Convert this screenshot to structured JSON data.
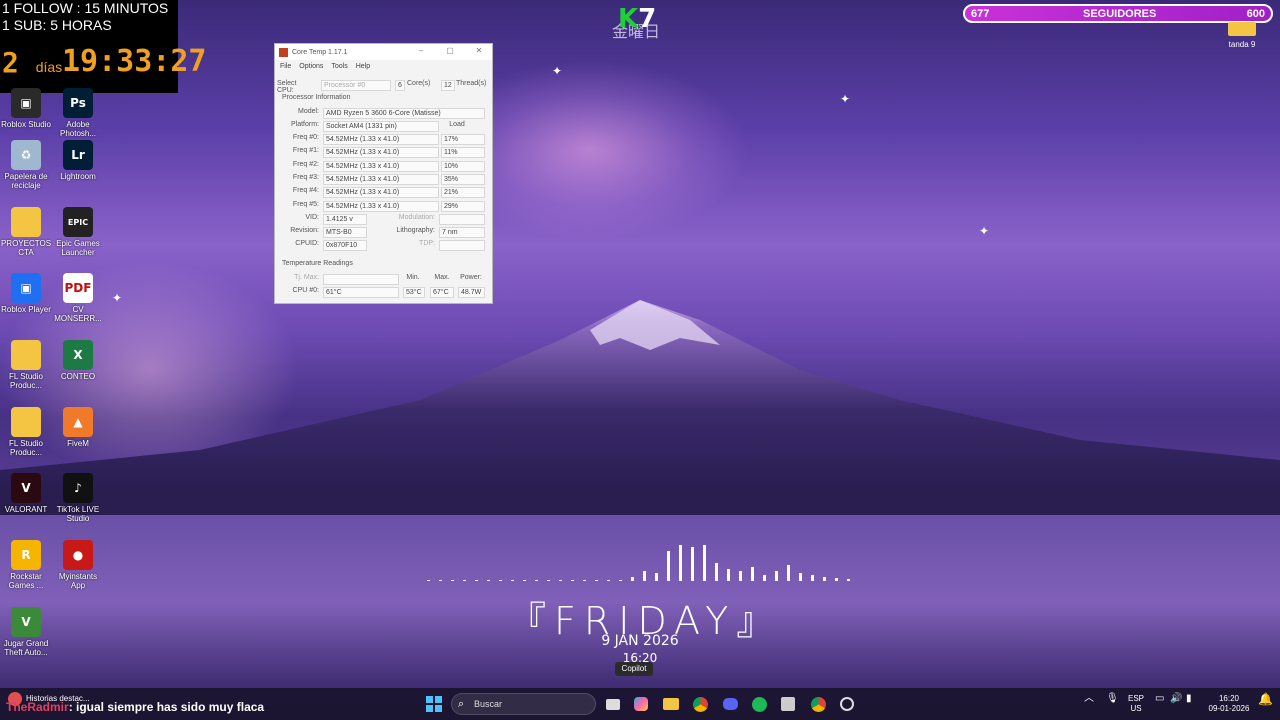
{
  "overlay": {
    "follow_goal": "1 FOLLOW : 15 MINUTOS",
    "sub_goal": "1 SUB: 5 HORAS",
    "timer_days": "2",
    "timer_days_unit": "días",
    "timer_clock": "19:33:27"
  },
  "logo": {
    "k": "K",
    "seven": "7",
    "kanji": "金曜日"
  },
  "followers_bar": {
    "current": "677",
    "label": "SEGUIDORES",
    "goal": "600",
    "fill_fraction": 1.0
  },
  "top_right_folder": {
    "label": "tanda 9"
  },
  "desktop_icons": [
    {
      "label": "Roblox Studio",
      "icon": "roblox-studio-icon"
    },
    {
      "label": "Adobe Photosh...",
      "icon": "photoshop-icon"
    },
    {
      "label": "Papelera de reciclaje",
      "icon": "recycle-bin-icon"
    },
    {
      "label": "Lightroom",
      "icon": "lightroom-icon"
    },
    {
      "label": "PROYECTOS CTA",
      "icon": "folder-icon"
    },
    {
      "label": "Epic Games Launcher",
      "icon": "epic-games-icon"
    },
    {
      "label": "Roblox Player",
      "icon": "roblox-icon"
    },
    {
      "label": "CV MONSERR...",
      "icon": "pdf-icon"
    },
    {
      "label": "FL Studio Produc...",
      "icon": "folder-icon"
    },
    {
      "label": "CONTEO",
      "icon": "excel-icon"
    },
    {
      "label": "FL Studio Produc...",
      "icon": "folder-icon"
    },
    {
      "label": "FiveM",
      "icon": "fivem-icon"
    },
    {
      "label": "VALORANT",
      "icon": "valorant-icon"
    },
    {
      "label": "TikTok LIVE Studio",
      "icon": "tiktok-icon"
    },
    {
      "label": "Rockstar Games ...",
      "icon": "rockstar-icon"
    },
    {
      "label": "Myinstants App",
      "icon": "myinstants-icon"
    },
    {
      "label": "Jugar Grand Theft Auto...",
      "icon": "gta-icon"
    }
  ],
  "coretemp": {
    "title": "Core Temp 1.17.1",
    "menu": [
      "File",
      "Options",
      "Tools",
      "Help"
    ],
    "select_cpu_label": "Select CPU:",
    "processor_value": "Processor #0",
    "cores_value": "6",
    "cores_label": "Core(s)",
    "threads_value": "12",
    "threads_label": "Thread(s)",
    "proc_info_label": "Processor Information",
    "model_label": "Model:",
    "model_value": "AMD Ryzen 5 3600 6-Core (Matisse)",
    "platform_label": "Platform:",
    "platform_value": "Socket AM4 (1331 pin)",
    "load_label": "Load",
    "freqs": [
      {
        "label": "Freq #0:",
        "value": "54.52MHz (1.33 x 41.0)",
        "load": "17%"
      },
      {
        "label": "Freq #1:",
        "value": "54.52MHz (1.33 x 41.0)",
        "load": "11%"
      },
      {
        "label": "Freq #2:",
        "value": "54.52MHz (1.33 x 41.0)",
        "load": "10%"
      },
      {
        "label": "Freq #3:",
        "value": "54.52MHz (1.33 x 41.0)",
        "load": "35%"
      },
      {
        "label": "Freq #4:",
        "value": "54.52MHz (1.33 x 41.0)",
        "load": "21%"
      },
      {
        "label": "Freq #5:",
        "value": "54.52MHz (1.33 x 41.0)",
        "load": "29%"
      }
    ],
    "vid_label": "VID:",
    "vid_value": "1.4125 v",
    "modulation_label": "Modulation:",
    "revision_label": "Revision:",
    "revision_value": "MTS-B0",
    "lithography_label": "Lithography:",
    "lithography_value": "7 nm",
    "cpuid_label": "CPUID:",
    "cpuid_value": "0x870F10",
    "tdp_label": "TDP:",
    "temp_label": "Temperature Readings",
    "tjmax_label": "Tj. Max:",
    "min_label": "Min.",
    "max_label": "Max.",
    "power_label": "Power:",
    "cpu0_label": "CPU #0:",
    "cpu0_value": "61°C",
    "cpu0_min": "53°C",
    "cpu0_max": "67°C",
    "cpu0_power": "48.7W"
  },
  "date_widget": {
    "day": "『FRIDAY』",
    "date": "9 JAN 2026",
    "time": "16:20",
    "tooltip": "Copilot"
  },
  "taskbar": {
    "news": "Historias destac...",
    "subtitle_name": "TheRadmir",
    "subtitle_text": ": igual siempre has sido muy flaca",
    "search_placeholder": "Buscar",
    "lang_top": "ESP",
    "lang_bottom": "US",
    "clock_time": "16:20",
    "clock_date": "09-01-2026"
  }
}
